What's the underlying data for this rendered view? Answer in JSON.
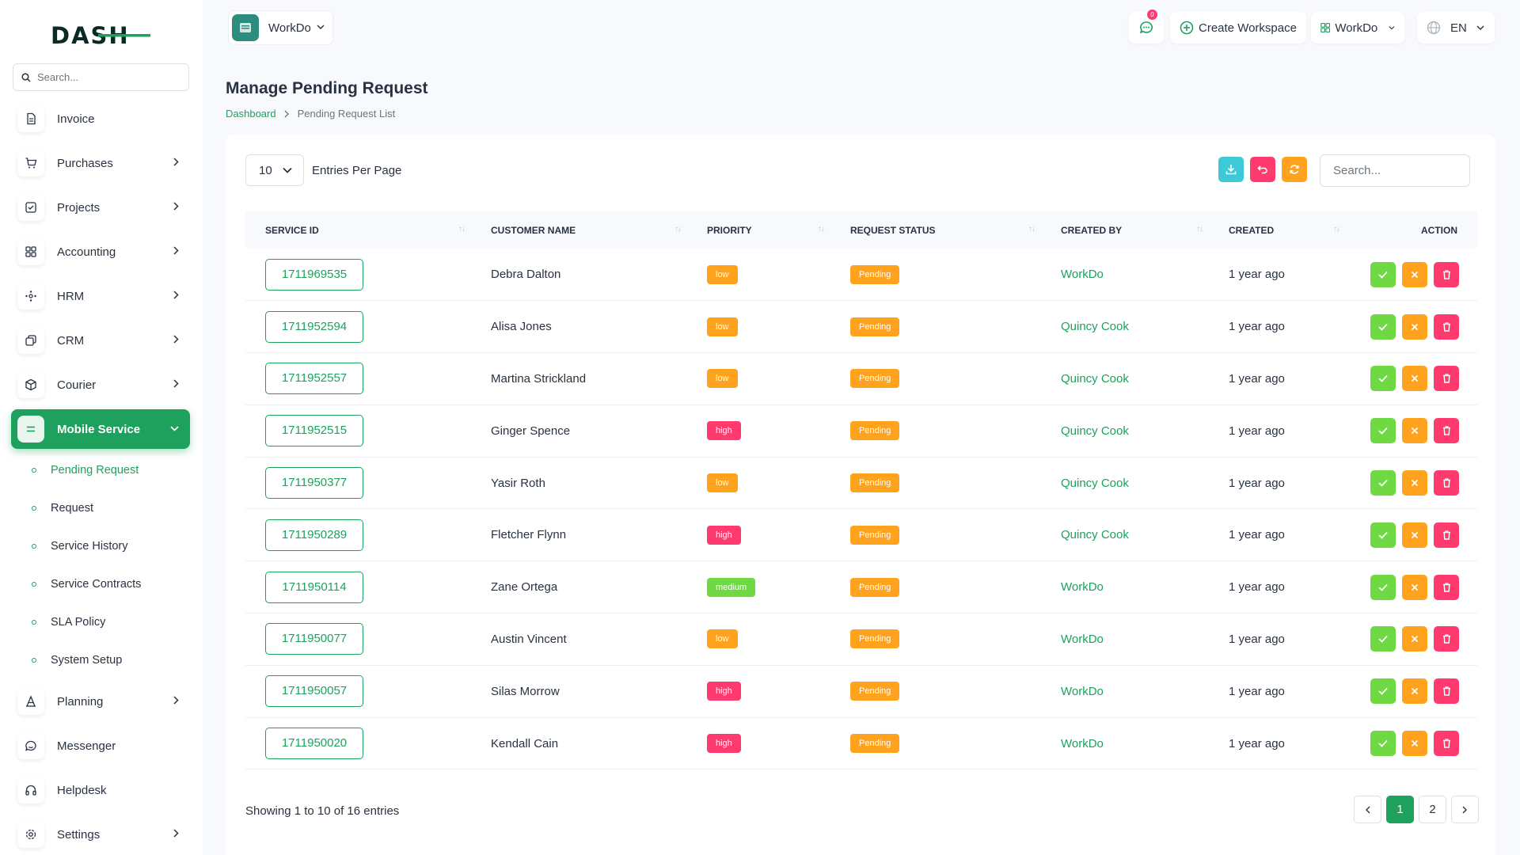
{
  "brand": {
    "logo_text": "DASH",
    "accent": "#1da15d"
  },
  "sidebar": {
    "search_placeholder": "Search...",
    "items": [
      {
        "label": "Invoice",
        "icon": "invoice-icon",
        "has_children": false
      },
      {
        "label": "Purchases",
        "icon": "cart-icon",
        "has_children": true
      },
      {
        "label": "Projects",
        "icon": "check-square-icon",
        "has_children": true
      },
      {
        "label": "Accounting",
        "icon": "grid-icon",
        "has_children": true
      },
      {
        "label": "HRM",
        "icon": "users-icon",
        "has_children": true
      },
      {
        "label": "CRM",
        "icon": "layers-icon",
        "has_children": true
      },
      {
        "label": "Courier",
        "icon": "package-icon",
        "has_children": true
      },
      {
        "label": "Mobile Service",
        "icon": "menu-icon",
        "has_children": true,
        "active": true
      }
    ],
    "submenu": [
      {
        "label": "Pending Request",
        "active": true
      },
      {
        "label": "Request"
      },
      {
        "label": "Service History"
      },
      {
        "label": "Service Contracts"
      },
      {
        "label": "SLA Policy"
      },
      {
        "label": "System Setup"
      }
    ],
    "items_after": [
      {
        "label": "Planning",
        "icon": "planning-icon",
        "has_children": true
      },
      {
        "label": "Messenger",
        "icon": "chat-icon",
        "has_children": false
      },
      {
        "label": "Helpdesk",
        "icon": "headphones-icon",
        "has_children": false
      },
      {
        "label": "Settings",
        "icon": "gear-icon",
        "has_children": true
      }
    ]
  },
  "header": {
    "workspace": "WorkDo",
    "notification_count": "0",
    "create_workspace": "Create Workspace",
    "workspace_menu": "WorkDo",
    "language": "EN"
  },
  "page": {
    "title": "Manage Pending Request",
    "breadcrumb": {
      "home": "Dashboard",
      "current": "Pending Request List"
    }
  },
  "table_controls": {
    "entries_value": "10",
    "entries_label": "Entries Per Page",
    "search_placeholder": "Search..."
  },
  "table": {
    "columns": [
      "SERVICE ID",
      "CUSTOMER NAME",
      "PRIORITY",
      "REQUEST STATUS",
      "CREATED BY",
      "CREATED",
      "ACTION"
    ],
    "rows": [
      {
        "id": "1711969535",
        "customer": "Debra Dalton",
        "priority": "low",
        "status": "Pending",
        "created_by": "WorkDo",
        "created": "1 year ago"
      },
      {
        "id": "1711952594",
        "customer": "Alisa Jones",
        "priority": "low",
        "status": "Pending",
        "created_by": "Quincy Cook",
        "created": "1 year ago"
      },
      {
        "id": "1711952557",
        "customer": "Martina Strickland",
        "priority": "low",
        "status": "Pending",
        "created_by": "Quincy Cook",
        "created": "1 year ago"
      },
      {
        "id": "1711952515",
        "customer": "Ginger Spence",
        "priority": "high",
        "status": "Pending",
        "created_by": "Quincy Cook",
        "created": "1 year ago"
      },
      {
        "id": "1711950377",
        "customer": "Yasir Roth",
        "priority": "low",
        "status": "Pending",
        "created_by": "Quincy Cook",
        "created": "1 year ago"
      },
      {
        "id": "1711950289",
        "customer": "Fletcher Flynn",
        "priority": "high",
        "status": "Pending",
        "created_by": "Quincy Cook",
        "created": "1 year ago"
      },
      {
        "id": "1711950114",
        "customer": "Zane Ortega",
        "priority": "medium",
        "status": "Pending",
        "created_by": "WorkDo",
        "created": "1 year ago"
      },
      {
        "id": "1711950077",
        "customer": "Austin Vincent",
        "priority": "low",
        "status": "Pending",
        "created_by": "WorkDo",
        "created": "1 year ago"
      },
      {
        "id": "1711950057",
        "customer": "Silas Morrow",
        "priority": "high",
        "status": "Pending",
        "created_by": "WorkDo",
        "created": "1 year ago"
      },
      {
        "id": "1711950020",
        "customer": "Kendall Cain",
        "priority": "high",
        "status": "Pending",
        "created_by": "WorkDo",
        "created": "1 year ago"
      }
    ]
  },
  "footer": {
    "showing": "Showing 1 to 10 of 16 entries",
    "pages": [
      "1",
      "2"
    ],
    "current_page": "1"
  },
  "colors": {
    "low": "#ffa21d",
    "high": "#ff3a6e",
    "medium": "#6fd943",
    "pending": "#ffa21d"
  }
}
